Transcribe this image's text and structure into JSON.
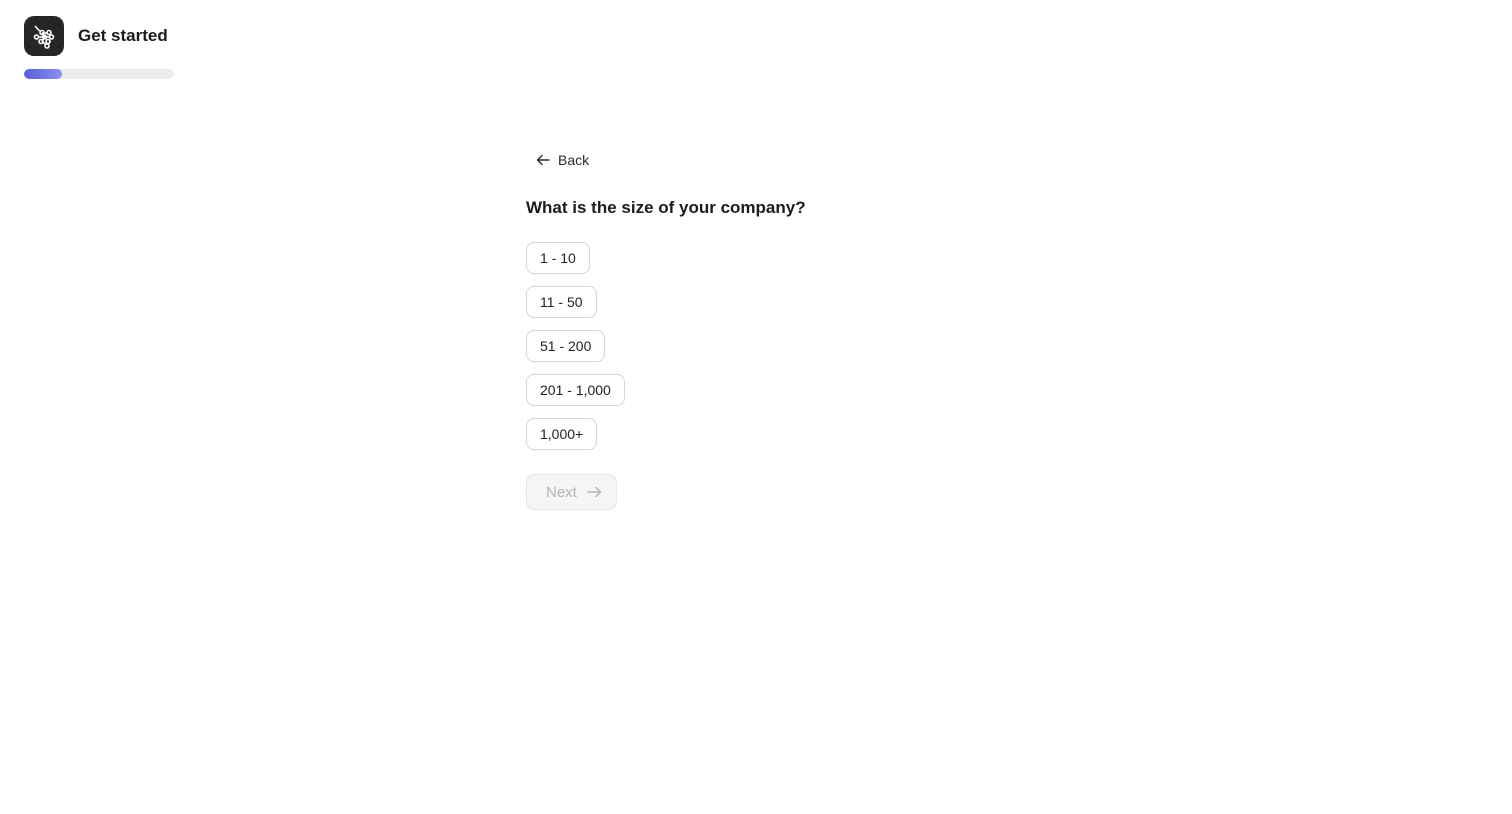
{
  "header": {
    "title": "Get started",
    "logo_icon": "molecule-icon"
  },
  "progress": {
    "percent": 25,
    "color": "#5b5fd6"
  },
  "navigation": {
    "back_label": "Back",
    "back_icon": "arrow-left-icon"
  },
  "question": {
    "text": "What is the size of your company?",
    "options": [
      {
        "label": "1 - 10"
      },
      {
        "label": "11 - 50"
      },
      {
        "label": "51 - 200"
      },
      {
        "label": "201 - 1,000"
      },
      {
        "label": "1,000+"
      }
    ]
  },
  "actions": {
    "next_label": "Next",
    "next_icon": "arrow-right-icon",
    "next_disabled": true
  }
}
